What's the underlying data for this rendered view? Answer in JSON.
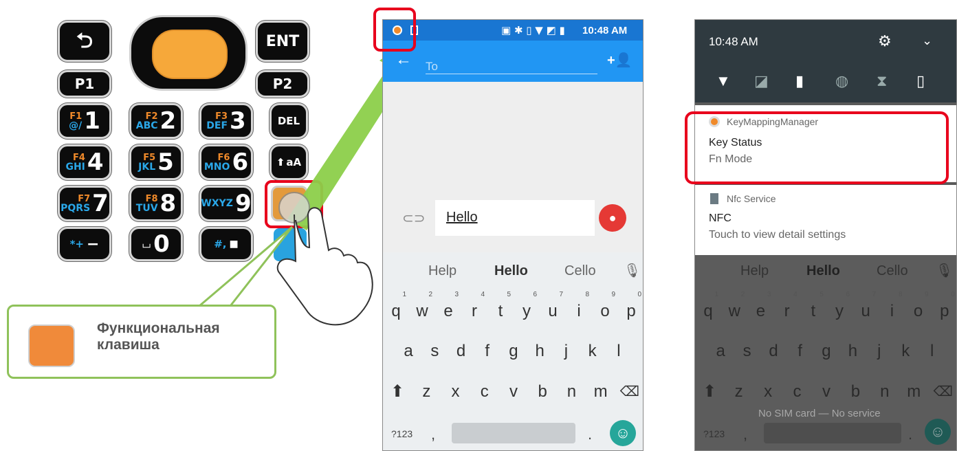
{
  "keypad": {
    "back_label": "⮌",
    "ent_label": "ENT",
    "p1_label": "P1",
    "p2_label": "P2",
    "del_label": "DEL",
    "shift_label": "aA",
    "keys": [
      {
        "fn": "F1",
        "letters": "@/",
        "digit": "1"
      },
      {
        "fn": "F2",
        "letters": "ABC",
        "digit": "2"
      },
      {
        "fn": "F3",
        "letters": "DEF",
        "digit": "3"
      },
      {
        "fn": "F4",
        "letters": "GHI",
        "digit": "4"
      },
      {
        "fn": "F5",
        "letters": "JKL",
        "digit": "5"
      },
      {
        "fn": "F6",
        "letters": "MNO",
        "digit": "6"
      },
      {
        "fn": "F7",
        "letters": "PQRS",
        "digit": "7"
      },
      {
        "fn": "F8",
        "letters": "TUV",
        "digit": "8"
      },
      {
        "fn": "",
        "letters": "WXYZ",
        "digit": "9"
      }
    ],
    "star_symbols": "*+",
    "star_main": "−",
    "zero_symbol": "⌴",
    "zero_digit": "0",
    "hash_symbols": "#,",
    "hash_main": "■",
    "accent_orange": "#f08a2a",
    "accent_blue": "#2aa7e8"
  },
  "callout": {
    "text": "Функциональная клавиша",
    "color": "#8fc25a",
    "key_color": "#f08a3a"
  },
  "phone1": {
    "status_time": "10:48 AM",
    "to_placeholder": "To",
    "message_text": "Hello",
    "toolbar_color": "#2196f3",
    "suggestions": [
      "Help",
      "Hello",
      "Cello"
    ],
    "row1": [
      [
        "q",
        "1"
      ],
      [
        "w",
        "2"
      ],
      [
        "e",
        "3"
      ],
      [
        "r",
        "4"
      ],
      [
        "t",
        "5"
      ],
      [
        "y",
        "6"
      ],
      [
        "u",
        "7"
      ],
      [
        "i",
        "8"
      ],
      [
        "o",
        "9"
      ],
      [
        "p",
        "0"
      ]
    ],
    "row2": [
      "a",
      "s",
      "d",
      "f",
      "g",
      "h",
      "j",
      "k",
      "l"
    ],
    "row3": [
      "z",
      "x",
      "c",
      "v",
      "b",
      "n",
      "m"
    ],
    "sym_label": "?123",
    "comma": ",",
    "period": "."
  },
  "phone2": {
    "time": "10:48 AM",
    "notif1_app": "KeyMappingManager",
    "notif1_title": "Key Status",
    "notif1_text": "Fn Mode",
    "notif2_app": "Nfc Service",
    "notif2_title": "NFC",
    "notif2_text": "Touch to view detail settings",
    "no_sim": "No SIM card — No service",
    "suggestions": [
      "Help",
      "Hello",
      "Cello"
    ],
    "row1": [
      [
        "q",
        "1"
      ],
      [
        "w",
        "2"
      ],
      [
        "e",
        "3"
      ],
      [
        "r",
        "4"
      ],
      [
        "t",
        "5"
      ],
      [
        "y",
        "6"
      ],
      [
        "u",
        "7"
      ],
      [
        "i",
        "8"
      ],
      [
        "o",
        "9"
      ],
      [
        "p",
        "0"
      ]
    ],
    "row2": [
      "a",
      "s",
      "d",
      "f",
      "g",
      "h",
      "j",
      "k",
      "l"
    ],
    "row3": [
      "z",
      "x",
      "c",
      "v",
      "b",
      "n",
      "m"
    ],
    "sym_label": "?123",
    "comma": ",",
    "period": "."
  },
  "highlight_color": "#e8001c"
}
